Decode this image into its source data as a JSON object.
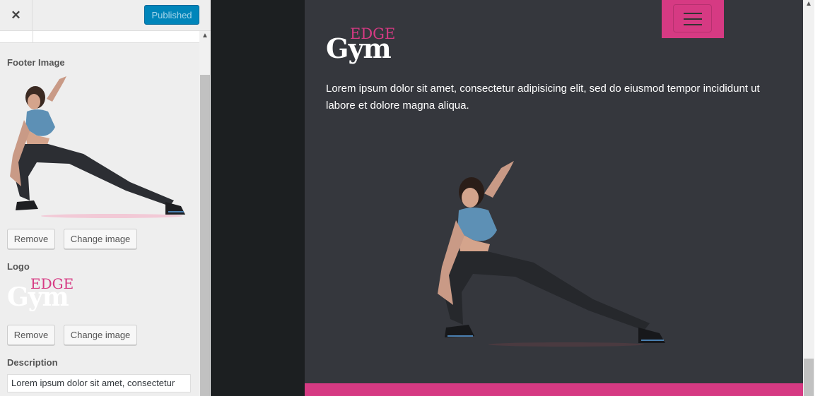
{
  "header": {
    "close_icon": "close-icon",
    "publish_label": "Published"
  },
  "sidebar": {
    "footer_image": {
      "label": "Footer Image",
      "remove_label": "Remove",
      "change_label": "Change image"
    },
    "logo": {
      "label": "Logo",
      "remove_label": "Remove",
      "change_label": "Change image"
    },
    "description": {
      "label": "Description",
      "value": "Lorem ipsum dolor sit amet, consectetur"
    }
  },
  "logo": {
    "edge": "EDGE",
    "gym": "Gym"
  },
  "preview": {
    "description": "Lorem ipsum dolor sit amet, consectetur adipisicing elit, sed do eiusmod tempor incididunt ut labore et dolore magna aliqua.",
    "menu_icon": "hamburger-menu-icon"
  },
  "colors": {
    "accent": "#d63a83",
    "site_bg": "#35373d",
    "publish": "#0085ba"
  }
}
